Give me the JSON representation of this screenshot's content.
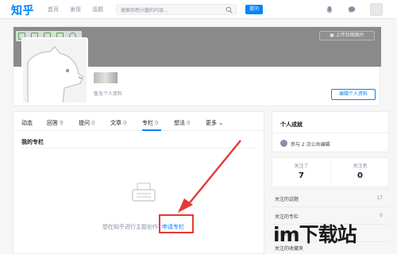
{
  "colors": {
    "brand": "#0084ff",
    "muted_text": "#8590a6",
    "annotation": "#e53935"
  },
  "navbar": {
    "logo": "知乎",
    "links": [
      "首页",
      "发现",
      "话题"
    ],
    "search_placeholder": "搜索你感兴趣的内容...",
    "ask_label": "提问",
    "icons": [
      "search-icon",
      "bell-icon",
      "message-icon"
    ]
  },
  "profile": {
    "upload_cover_label": "上传封面图片",
    "no_info": "暂无个人资料",
    "edit_label": "编辑个人资料"
  },
  "tabs": [
    {
      "label": "动态",
      "count": ""
    },
    {
      "label": "回答",
      "count": "9"
    },
    {
      "label": "提问",
      "count": "0"
    },
    {
      "label": "文章",
      "count": "0"
    },
    {
      "label": "专栏",
      "count": "0"
    },
    {
      "label": "想法",
      "count": "0"
    },
    {
      "label": "更多",
      "count": ""
    }
  ],
  "active_tab": "专栏",
  "columns_section": {
    "title": "我的专栏",
    "empty_text": "想在知乎进行主题创作？",
    "apply_link": "申请专栏"
  },
  "sidebar": {
    "achievement_title": "个人成就",
    "achievement_text": "参与 2 次公共编辑",
    "following_label": "关注了",
    "following_count": "7",
    "followers_label": "关注者",
    "followers_count": "0",
    "list": [
      {
        "label": "关注的话题",
        "count": "17"
      },
      {
        "label": "关注的专栏",
        "count": "0"
      },
      {
        "label": "关注的问题",
        "count": ""
      },
      {
        "label": "关注的收藏夹",
        "count": ""
      }
    ]
  },
  "watermark": "im下载站"
}
